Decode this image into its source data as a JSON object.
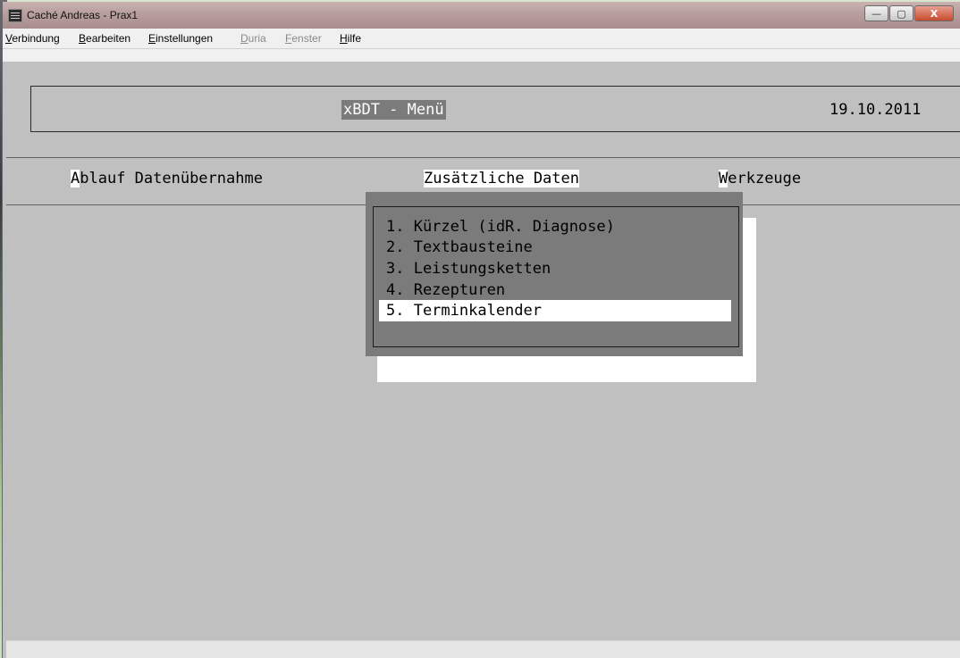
{
  "window": {
    "title": "Caché Andreas - Prax1",
    "buttons": {
      "minimize": "—",
      "maximize": "▢",
      "close": "X"
    }
  },
  "menubar": {
    "items": [
      {
        "label": "Verbindung",
        "hotkey": "V",
        "rest": "erbindung",
        "enabled": true
      },
      {
        "label": "Bearbeiten",
        "hotkey": "B",
        "rest": "earbeiten",
        "enabled": true
      },
      {
        "label": "Einstellungen",
        "hotkey": "E",
        "rest": "instellungen",
        "enabled": true
      },
      {
        "label": "Duria",
        "hotkey": "D",
        "rest": "uria",
        "enabled": false
      },
      {
        "label": "Fenster",
        "hotkey": "F",
        "rest": "enster",
        "enabled": false
      },
      {
        "label": "Hilfe",
        "hotkey": "H",
        "rest": "ilfe",
        "enabled": true
      }
    ]
  },
  "screen": {
    "title": "xBDT - Menü",
    "date": "19.10.2011"
  },
  "mainmenu": {
    "items": [
      {
        "hot": "A",
        "rest": "blauf Datenübernahme"
      },
      {
        "hot": "",
        "rest": "Zusätzliche Daten"
      },
      {
        "hot": "W",
        "rest": "erkzeuge"
      }
    ]
  },
  "dropdown": {
    "items": [
      "1. Kürzel (idR. Diagnose)",
      "2. Textbausteine",
      "3. Leistungsketten",
      "4. Rezepturen",
      "5. Terminkalender"
    ],
    "selected_index": 4
  },
  "colors": {
    "terminal_bg": "#c0c0c0",
    "highlight": "#7b7b7b",
    "selection": "#ffffff"
  }
}
